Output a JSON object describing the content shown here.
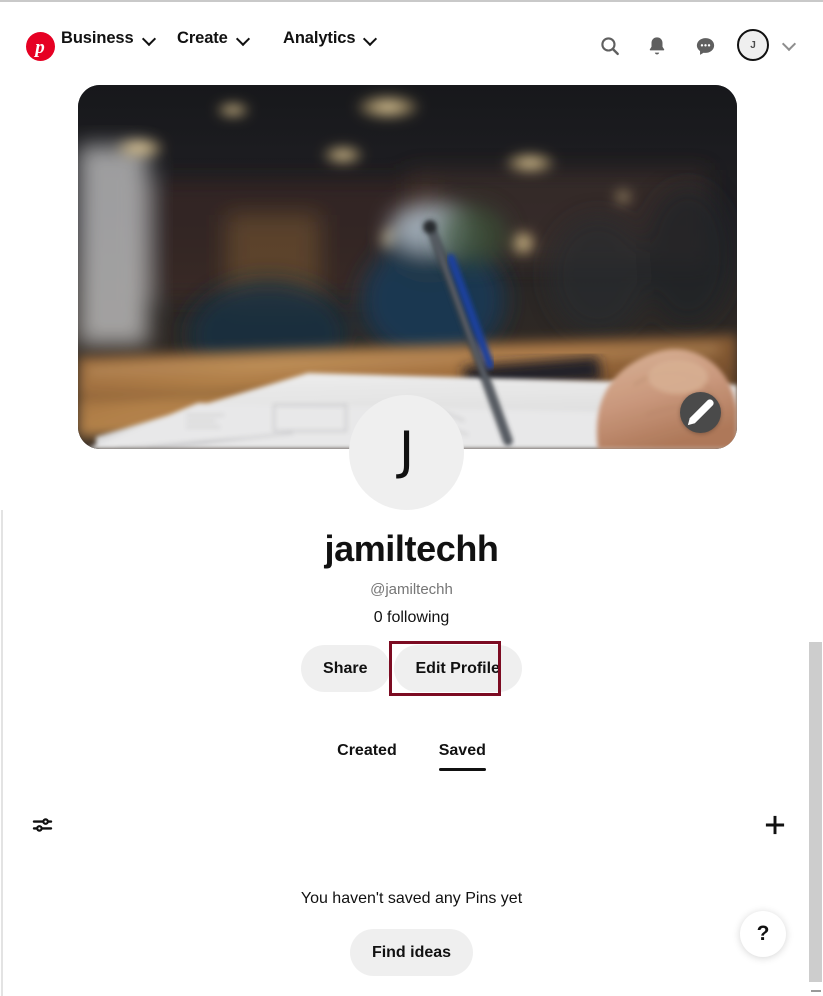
{
  "header": {
    "logo_icon": "pinterest-logo-icon",
    "logo_glyph": "p",
    "nav": [
      {
        "label": "Business",
        "icon": "chevron-down-icon"
      },
      {
        "label": "Create",
        "icon": "chevron-down-icon"
      },
      {
        "label": "Analytics",
        "icon": "chevron-down-icon"
      }
    ],
    "actions": [
      {
        "name": "search-icon"
      },
      {
        "name": "bell-icon"
      },
      {
        "name": "messages-icon"
      }
    ],
    "avatar_initial": "J",
    "account_chevron_icon": "chevron-down-icon"
  },
  "cover": {
    "alt": "blurred cafe photo of a hand sketching on paper",
    "edit_icon": "pencil-icon"
  },
  "profile": {
    "avatar_initial": "J",
    "display_name": "jamiltechh",
    "handle": "@jamiltechh",
    "following": "0 following",
    "share_label": "Share",
    "edit_profile_label": "Edit Profile"
  },
  "tabs": [
    {
      "label": "Created",
      "active": false
    },
    {
      "label": "Saved",
      "active": true
    }
  ],
  "toolbar": {
    "filter_icon": "sliders-filter-icon",
    "add_icon": "plus-icon"
  },
  "empty_state": {
    "message": "You haven't saved any Pins yet",
    "cta_label": "Find ideas"
  },
  "help": {
    "glyph": "?",
    "name": "help-icon"
  },
  "colors": {
    "brand_red": "#e60023",
    "annotation": "#7c0b22",
    "pill_bg": "#efefef",
    "text": "#111111",
    "muted_text": "#767676"
  }
}
